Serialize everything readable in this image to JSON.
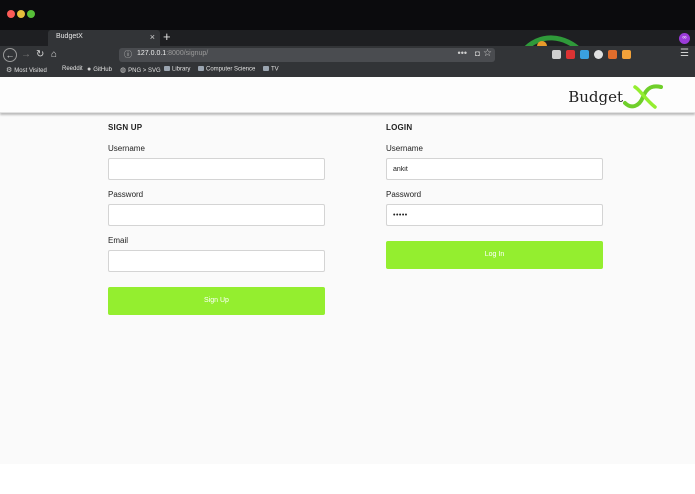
{
  "browser": {
    "tab_title": "BudgetX",
    "tab_close": "×",
    "new_tab": "+",
    "url_info": "ⓘ",
    "url_host": "127.0.0.1",
    "url_rest": ":8000/signup/",
    "url_more": "•••",
    "private_icon": "∞",
    "bookmarks": [
      "Most Visited",
      "Reeddit",
      "GitHub",
      "PNG > SVG",
      "Library",
      "Computer Science",
      "TV"
    ]
  },
  "site": {
    "brand_text": "Budget",
    "brand_mark": "X",
    "accent_color": "#94ee2f"
  },
  "signup": {
    "title": "SIGN UP",
    "username_label": "Username",
    "username_value": "",
    "password_label": "Password",
    "password_value": "",
    "email_label": "Email",
    "email_value": "",
    "button_label": "Sign Up"
  },
  "login": {
    "title": "LOGIN",
    "username_label": "Username",
    "username_value": "ankit",
    "password_label": "Password",
    "password_value": "•••••",
    "button_label": "Log In"
  }
}
